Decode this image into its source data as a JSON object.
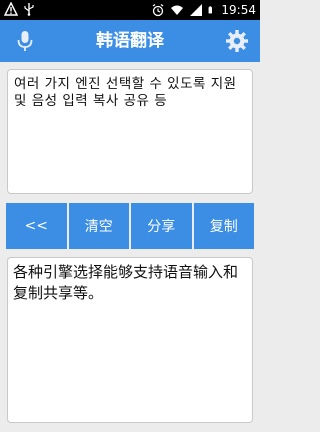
{
  "status_bar": {
    "clock": "19:54",
    "icons": [
      "warning-icon",
      "usb-icon",
      "alarm-icon",
      "wifi-icon",
      "signal-icon",
      "battery-icon"
    ]
  },
  "app_bar": {
    "title": "韩语翻译",
    "left_icon": "microphone-icon",
    "right_icon": "gear-icon",
    "color": "#3b8ee4"
  },
  "input": {
    "text": "여러 가지 엔진 선택할 수 있도록 지원 및 음성 입력 복사 공유 등"
  },
  "buttons": {
    "back": "<<",
    "clear": "清空",
    "share": "分享",
    "copy": "复制"
  },
  "output": {
    "text": "各种引擎选择能够支持语音输入和复制共享等。"
  }
}
